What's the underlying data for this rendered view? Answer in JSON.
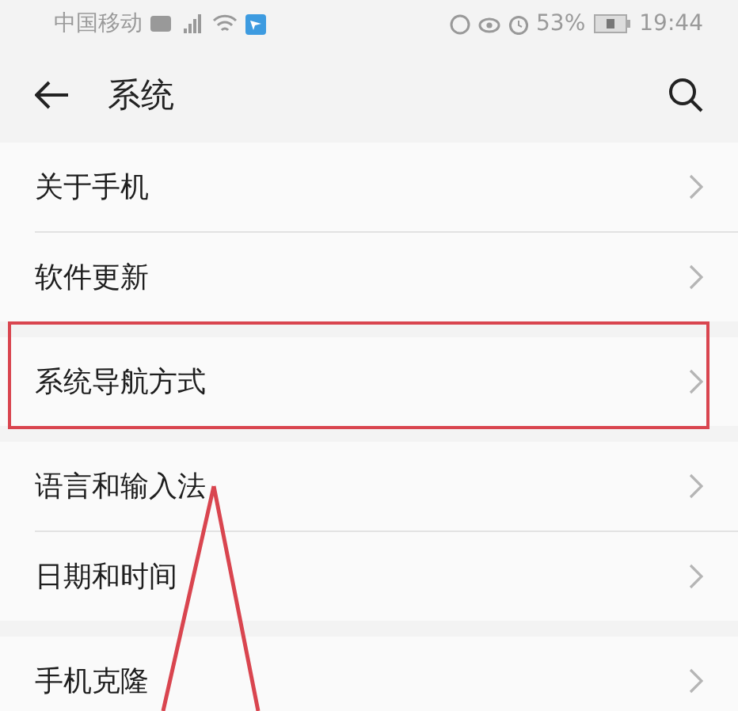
{
  "status_bar": {
    "carrier": "中国移动",
    "battery_percent": "53%",
    "time": "19:44"
  },
  "header": {
    "title": "系统"
  },
  "sections": [
    {
      "items": [
        {
          "label": "关于手机",
          "highlighted": false
        },
        {
          "label": "软件更新",
          "highlighted": false
        }
      ]
    },
    {
      "items": [
        {
          "label": "系统导航方式",
          "highlighted": true
        }
      ]
    },
    {
      "items": [
        {
          "label": "语言和输入法",
          "highlighted": false
        },
        {
          "label": "日期和时间",
          "highlighted": false
        }
      ]
    },
    {
      "items": [
        {
          "label": "手机克隆",
          "highlighted": false
        }
      ]
    }
  ]
}
